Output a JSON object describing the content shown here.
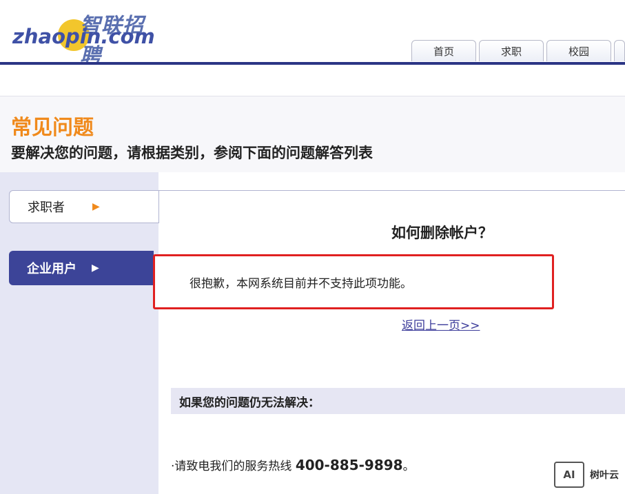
{
  "header": {
    "logo_cn": "智联招聘",
    "logo_en": "zhaopin.com",
    "tabs": [
      "首页",
      "求职",
      "校园"
    ]
  },
  "faq": {
    "title": "常见问题",
    "subtitle": "要解决您的问题，请根据类别，参阅下面的问题解答列表"
  },
  "sidebar": {
    "categories": [
      {
        "label": "求职者"
      },
      {
        "label": "企业用户"
      }
    ]
  },
  "content": {
    "question": "如何删除帐户？",
    "answer": "很抱歉，本网系统目前并不支持此项功能。",
    "back_link": "返回上一页>>",
    "help_heading": "如果您的问题仍无法解决：",
    "hotline_prefix": "·请致电我们的服务热线 ",
    "hotline_number": "400-885-9898",
    "hotline_suffix": "。"
  },
  "watermark": {
    "box": "AI",
    "text": "树叶云"
  },
  "colors": {
    "brand_navy": "#2b3585",
    "accent_orange": "#f08a1c",
    "highlight_red": "#e02020"
  }
}
